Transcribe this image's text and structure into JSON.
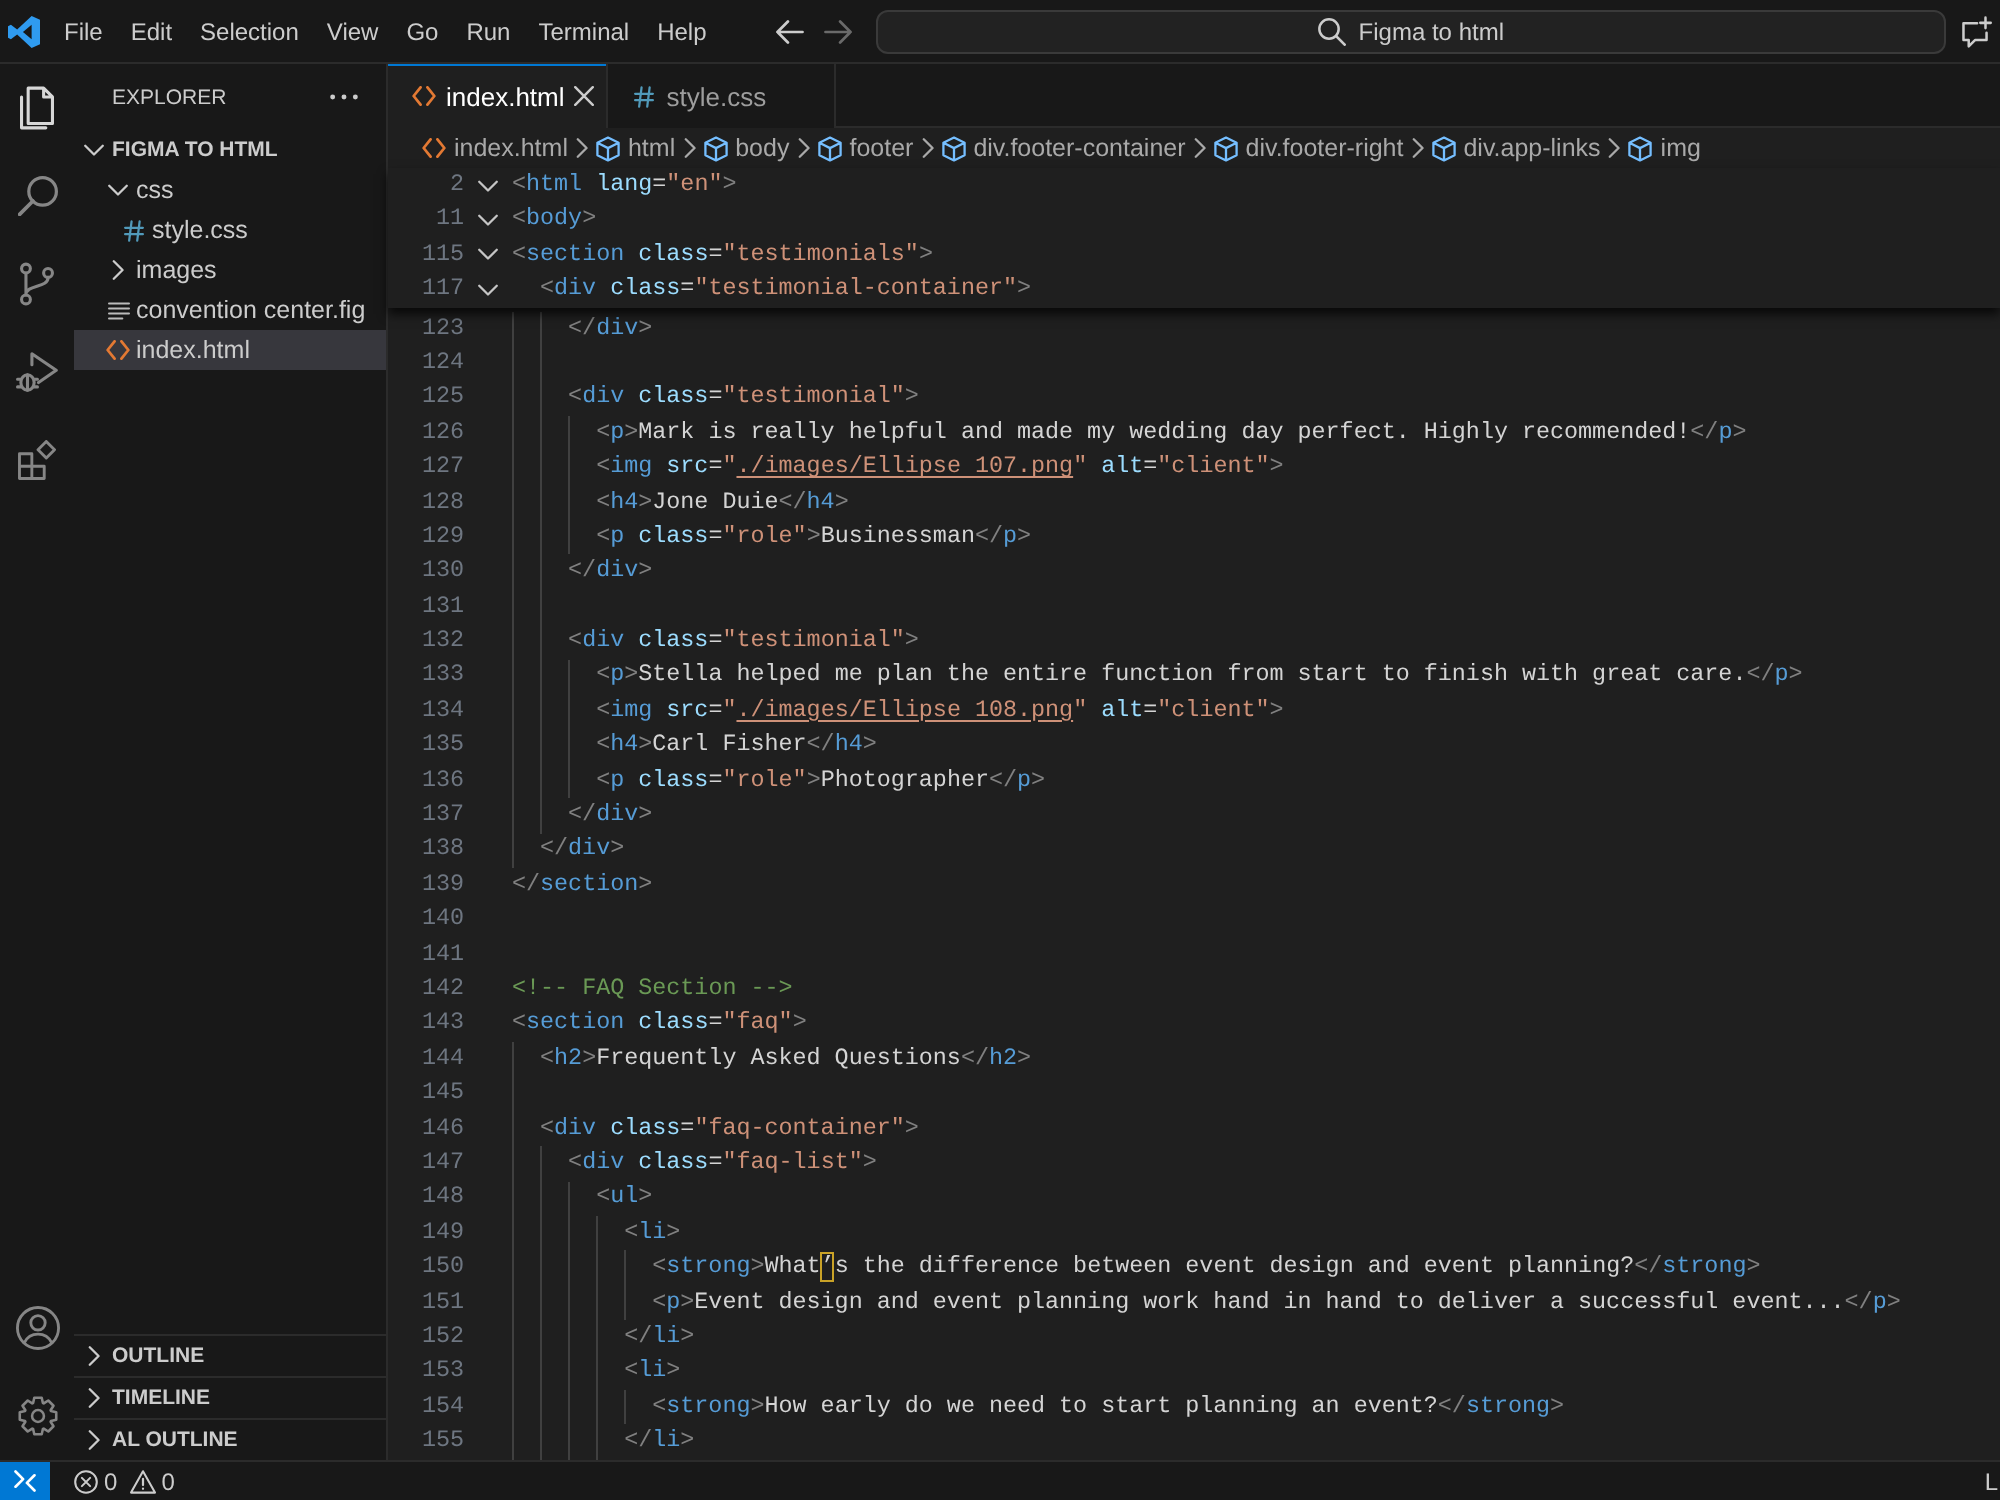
{
  "title_bar": {
    "menu": [
      "File",
      "Edit",
      "Selection",
      "View",
      "Go",
      "Run",
      "Terminal",
      "Help"
    ],
    "navigation": [
      {
        "kind": "back",
        "disabled": false
      },
      {
        "kind": "forward",
        "disabled": true
      }
    ],
    "command_center": {
      "label": "Figma to html"
    }
  },
  "activity_bar": {
    "items": [
      {
        "kind": "explorer",
        "selected": true
      },
      {
        "kind": "search",
        "selected": false
      },
      {
        "kind": "source_control",
        "selected": false
      },
      {
        "kind": "run_debug",
        "selected": false
      },
      {
        "kind": "extensions",
        "selected": false
      }
    ],
    "bottom": [
      {
        "kind": "account"
      },
      {
        "kind": "manage"
      }
    ]
  },
  "sidebar": {
    "title": "EXPLORER",
    "tree": {
      "label": "FIGMA TO HTML",
      "expanded": true,
      "children": [
        {
          "label": "css",
          "kind": "folder",
          "expanded": true,
          "selected": false,
          "children": [
            {
              "label": "style.css",
              "kind": "css",
              "selected": false
            }
          ]
        },
        {
          "label": "images",
          "kind": "folder",
          "expanded": false,
          "selected": false
        },
        {
          "label": "convention center.fig",
          "kind": "file",
          "selected": false
        },
        {
          "label": "index.html",
          "kind": "html",
          "selected": true
        }
      ]
    },
    "sections": [
      {
        "label": "OUTLINE",
        "expanded": false
      },
      {
        "label": "TIMELINE",
        "expanded": false
      },
      {
        "label": "AL OUTLINE",
        "expanded": false
      }
    ]
  },
  "editor": {
    "tabs": [
      {
        "label": "index.html",
        "kind": "html",
        "selected": true
      },
      {
        "label": "style.css",
        "kind": "css",
        "selected": false
      }
    ],
    "breadcrumbs": [
      {
        "label": "index.html",
        "kind": "html"
      },
      {
        "label": "html",
        "kind": "element"
      },
      {
        "label": "body",
        "kind": "element"
      },
      {
        "label": "footer",
        "kind": "element"
      },
      {
        "label": "div.footer-container",
        "kind": "element"
      },
      {
        "label": "div.footer-right",
        "kind": "element"
      },
      {
        "label": "div.app-links",
        "kind": "element"
      },
      {
        "label": "img",
        "kind": "element"
      }
    ],
    "sticky_scroll": [
      {
        "number": "2",
        "expanded": true,
        "tokens": [
          {
            "kind": "bracket",
            "text": "<"
          },
          {
            "kind": "tag",
            "text": "html"
          },
          {
            "kind": "attribute",
            "text": " lang"
          },
          {
            "kind": "plain",
            "text": "="
          },
          {
            "kind": "string",
            "text": "\"en\""
          },
          {
            "kind": "bracket",
            "text": ">"
          }
        ]
      },
      {
        "number": "11",
        "expanded": true,
        "tokens": [
          {
            "kind": "bracket",
            "text": "<"
          },
          {
            "kind": "tag",
            "text": "body"
          },
          {
            "kind": "bracket",
            "text": ">"
          }
        ]
      },
      {
        "number": "115",
        "expanded": true,
        "tokens": [
          {
            "kind": "bracket",
            "text": "<"
          },
          {
            "kind": "tag",
            "text": "section"
          },
          {
            "kind": "attribute",
            "text": " class"
          },
          {
            "kind": "plain",
            "text": "="
          },
          {
            "kind": "string",
            "text": "\"testimonials\""
          },
          {
            "kind": "bracket",
            "text": ">"
          }
        ]
      },
      {
        "number": "117",
        "expanded": true,
        "tokens": [
          {
            "kind": "bracket",
            "text": "  <"
          },
          {
            "kind": "tag",
            "text": "div"
          },
          {
            "kind": "attribute",
            "text": " class"
          },
          {
            "kind": "plain",
            "text": "="
          },
          {
            "kind": "string",
            "text": "\"testimonial-container\""
          },
          {
            "kind": "bracket",
            "text": ">"
          }
        ]
      }
    ],
    "lines": [
      {
        "number": "123",
        "tokens": [
          {
            "kind": "bracket",
            "text": "    </"
          },
          {
            "kind": "tag",
            "text": "div"
          },
          {
            "kind": "bracket",
            "text": ">"
          }
        ]
      },
      {
        "number": "124"
      },
      {
        "number": "125",
        "tokens": [
          {
            "kind": "bracket",
            "text": "    <"
          },
          {
            "kind": "tag",
            "text": "div"
          },
          {
            "kind": "attribute",
            "text": " class"
          },
          {
            "kind": "plain",
            "text": "="
          },
          {
            "kind": "string",
            "text": "\"testimonial\""
          },
          {
            "kind": "bracket",
            "text": ">"
          }
        ]
      },
      {
        "number": "126",
        "tokens": [
          {
            "kind": "bracket",
            "text": "      <"
          },
          {
            "kind": "tag",
            "text": "p"
          },
          {
            "kind": "bracket",
            "text": ">"
          },
          {
            "kind": "plain",
            "text": "Mark is really helpful and made my wedding day perfect. Highly recommended!"
          },
          {
            "kind": "bracket",
            "text": "</"
          },
          {
            "kind": "tag",
            "text": "p"
          },
          {
            "kind": "bracket",
            "text": ">"
          }
        ]
      },
      {
        "number": "127",
        "tokens": [
          {
            "kind": "bracket",
            "text": "      <"
          },
          {
            "kind": "tag",
            "text": "img"
          },
          {
            "kind": "attribute",
            "text": " src"
          },
          {
            "kind": "plain",
            "text": "="
          },
          {
            "kind": "string",
            "text": "\""
          },
          {
            "kind": "link",
            "text": "./images/Ellipse 107.png"
          },
          {
            "kind": "string",
            "text": "\""
          },
          {
            "kind": "attribute",
            "text": " alt"
          },
          {
            "kind": "plain",
            "text": "="
          },
          {
            "kind": "string",
            "text": "\"client\""
          },
          {
            "kind": "bracket",
            "text": ">"
          }
        ]
      },
      {
        "number": "128",
        "tokens": [
          {
            "kind": "bracket",
            "text": "      <"
          },
          {
            "kind": "tag",
            "text": "h4"
          },
          {
            "kind": "bracket",
            "text": ">"
          },
          {
            "kind": "plain",
            "text": "Jone Duie"
          },
          {
            "kind": "bracket",
            "text": "</"
          },
          {
            "kind": "tag",
            "text": "h4"
          },
          {
            "kind": "bracket",
            "text": ">"
          }
        ]
      },
      {
        "number": "129",
        "tokens": [
          {
            "kind": "bracket",
            "text": "      <"
          },
          {
            "kind": "tag",
            "text": "p"
          },
          {
            "kind": "attribute",
            "text": " class"
          },
          {
            "kind": "plain",
            "text": "="
          },
          {
            "kind": "string",
            "text": "\"role\""
          },
          {
            "kind": "bracket",
            "text": ">"
          },
          {
            "kind": "plain",
            "text": "Businessman"
          },
          {
            "kind": "bracket",
            "text": "</"
          },
          {
            "kind": "tag",
            "text": "p"
          },
          {
            "kind": "bracket",
            "text": ">"
          }
        ]
      },
      {
        "number": "130",
        "tokens": [
          {
            "kind": "bracket",
            "text": "    </"
          },
          {
            "kind": "tag",
            "text": "div"
          },
          {
            "kind": "bracket",
            "text": ">"
          }
        ]
      },
      {
        "number": "131"
      },
      {
        "number": "132",
        "tokens": [
          {
            "kind": "bracket",
            "text": "    <"
          },
          {
            "kind": "tag",
            "text": "div"
          },
          {
            "kind": "attribute",
            "text": " class"
          },
          {
            "kind": "plain",
            "text": "="
          },
          {
            "kind": "string",
            "text": "\"testimonial\""
          },
          {
            "kind": "bracket",
            "text": ">"
          }
        ]
      },
      {
        "number": "133",
        "tokens": [
          {
            "kind": "bracket",
            "text": "      <"
          },
          {
            "kind": "tag",
            "text": "p"
          },
          {
            "kind": "bracket",
            "text": ">"
          },
          {
            "kind": "plain",
            "text": "Stella helped me plan the entire function from start to finish with great care."
          },
          {
            "kind": "bracket",
            "text": "</"
          },
          {
            "kind": "tag",
            "text": "p"
          },
          {
            "kind": "bracket",
            "text": ">"
          }
        ]
      },
      {
        "number": "134",
        "tokens": [
          {
            "kind": "bracket",
            "text": "      <"
          },
          {
            "kind": "tag",
            "text": "img"
          },
          {
            "kind": "attribute",
            "text": " src"
          },
          {
            "kind": "plain",
            "text": "="
          },
          {
            "kind": "string",
            "text": "\""
          },
          {
            "kind": "link",
            "text": "./images/Ellipse 108.png"
          },
          {
            "kind": "string",
            "text": "\""
          },
          {
            "kind": "attribute",
            "text": " alt"
          },
          {
            "kind": "plain",
            "text": "="
          },
          {
            "kind": "string",
            "text": "\"client\""
          },
          {
            "kind": "bracket",
            "text": ">"
          }
        ]
      },
      {
        "number": "135",
        "tokens": [
          {
            "kind": "bracket",
            "text": "      <"
          },
          {
            "kind": "tag",
            "text": "h4"
          },
          {
            "kind": "bracket",
            "text": ">"
          },
          {
            "kind": "plain",
            "text": "Carl Fisher"
          },
          {
            "kind": "bracket",
            "text": "</"
          },
          {
            "kind": "tag",
            "text": "h4"
          },
          {
            "kind": "bracket",
            "text": ">"
          }
        ]
      },
      {
        "number": "136",
        "tokens": [
          {
            "kind": "bracket",
            "text": "      <"
          },
          {
            "kind": "tag",
            "text": "p"
          },
          {
            "kind": "attribute",
            "text": " class"
          },
          {
            "kind": "plain",
            "text": "="
          },
          {
            "kind": "string",
            "text": "\"role\""
          },
          {
            "kind": "bracket",
            "text": ">"
          },
          {
            "kind": "plain",
            "text": "Photographer"
          },
          {
            "kind": "bracket",
            "text": "</"
          },
          {
            "kind": "tag",
            "text": "p"
          },
          {
            "kind": "bracket",
            "text": ">"
          }
        ]
      },
      {
        "number": "137",
        "tokens": [
          {
            "kind": "bracket",
            "text": "    </"
          },
          {
            "kind": "tag",
            "text": "div"
          },
          {
            "kind": "bracket",
            "text": ">"
          }
        ]
      },
      {
        "number": "138",
        "tokens": [
          {
            "kind": "bracket",
            "text": "  </"
          },
          {
            "kind": "tag",
            "text": "div"
          },
          {
            "kind": "bracket",
            "text": ">"
          }
        ]
      },
      {
        "number": "139",
        "tokens": [
          {
            "kind": "bracket",
            "text": "</"
          },
          {
            "kind": "tag",
            "text": "section"
          },
          {
            "kind": "bracket",
            "text": ">"
          }
        ]
      },
      {
        "number": "140"
      },
      {
        "number": "141"
      },
      {
        "number": "142",
        "tokens": [
          {
            "kind": "comment",
            "text": "<!-- FAQ Section -->"
          }
        ]
      },
      {
        "number": "143",
        "tokens": [
          {
            "kind": "bracket",
            "text": "<"
          },
          {
            "kind": "tag",
            "text": "section"
          },
          {
            "kind": "attribute",
            "text": " class"
          },
          {
            "kind": "plain",
            "text": "="
          },
          {
            "kind": "string",
            "text": "\"faq\""
          },
          {
            "kind": "bracket",
            "text": ">"
          }
        ]
      },
      {
        "number": "144",
        "tokens": [
          {
            "kind": "bracket",
            "text": "  <"
          },
          {
            "kind": "tag",
            "text": "h2"
          },
          {
            "kind": "bracket",
            "text": ">"
          },
          {
            "kind": "plain",
            "text": "Frequently Asked Questions"
          },
          {
            "kind": "bracket",
            "text": "</"
          },
          {
            "kind": "tag",
            "text": "h2"
          },
          {
            "kind": "bracket",
            "text": ">"
          }
        ]
      },
      {
        "number": "145"
      },
      {
        "number": "146",
        "tokens": [
          {
            "kind": "bracket",
            "text": "  <"
          },
          {
            "kind": "tag",
            "text": "div"
          },
          {
            "kind": "attribute",
            "text": " class"
          },
          {
            "kind": "plain",
            "text": "="
          },
          {
            "kind": "string",
            "text": "\"faq-container\""
          },
          {
            "kind": "bracket",
            "text": ">"
          }
        ]
      },
      {
        "number": "147",
        "tokens": [
          {
            "kind": "bracket",
            "text": "    <"
          },
          {
            "kind": "tag",
            "text": "div"
          },
          {
            "kind": "attribute",
            "text": " class"
          },
          {
            "kind": "plain",
            "text": "="
          },
          {
            "kind": "string",
            "text": "\"faq-list\""
          },
          {
            "kind": "bracket",
            "text": ">"
          }
        ]
      },
      {
        "number": "148",
        "tokens": [
          {
            "kind": "bracket",
            "text": "      <"
          },
          {
            "kind": "tag",
            "text": "ul"
          },
          {
            "kind": "bracket",
            "text": ">"
          }
        ]
      },
      {
        "number": "149",
        "tokens": [
          {
            "kind": "bracket",
            "text": "        <"
          },
          {
            "kind": "tag",
            "text": "li"
          },
          {
            "kind": "bracket",
            "text": ">"
          }
        ]
      },
      {
        "number": "150",
        "tokens": [
          {
            "kind": "bracket",
            "text": "          <"
          },
          {
            "kind": "tag",
            "text": "strong"
          },
          {
            "kind": "bracket",
            "text": ">"
          },
          {
            "kind": "plain",
            "text": "What"
          },
          {
            "kind": "ambiguous",
            "text": "’"
          },
          {
            "kind": "plain",
            "text": "s the difference between event design and event planning?"
          },
          {
            "kind": "bracket",
            "text": "</"
          },
          {
            "kind": "tag",
            "text": "strong"
          },
          {
            "kind": "bracket",
            "text": ">"
          }
        ]
      },
      {
        "number": "151",
        "tokens": [
          {
            "kind": "bracket",
            "text": "          <"
          },
          {
            "kind": "tag",
            "text": "p"
          },
          {
            "kind": "bracket",
            "text": ">"
          },
          {
            "kind": "plain",
            "text": "Event design and event planning work hand in hand to deliver a successful event..."
          },
          {
            "kind": "bracket",
            "text": "</"
          },
          {
            "kind": "tag",
            "text": "p"
          },
          {
            "kind": "bracket",
            "text": ">"
          }
        ]
      },
      {
        "number": "152",
        "tokens": [
          {
            "kind": "bracket",
            "text": "        </"
          },
          {
            "kind": "tag",
            "text": "li"
          },
          {
            "kind": "bracket",
            "text": ">"
          }
        ]
      },
      {
        "number": "153",
        "tokens": [
          {
            "kind": "bracket",
            "text": "        <"
          },
          {
            "kind": "tag",
            "text": "li"
          },
          {
            "kind": "bracket",
            "text": ">"
          }
        ]
      },
      {
        "number": "154",
        "tokens": [
          {
            "kind": "bracket",
            "text": "          <"
          },
          {
            "kind": "tag",
            "text": "strong"
          },
          {
            "kind": "bracket",
            "text": ">"
          },
          {
            "kind": "plain",
            "text": "How early do we need to start planning an event?"
          },
          {
            "kind": "bracket",
            "text": "</"
          },
          {
            "kind": "tag",
            "text": "strong"
          },
          {
            "kind": "bracket",
            "text": ">"
          }
        ]
      },
      {
        "number": "155",
        "tokens": [
          {
            "kind": "bracket",
            "text": "        </"
          },
          {
            "kind": "tag",
            "text": "li"
          },
          {
            "kind": "bracket",
            "text": ">"
          }
        ]
      }
    ]
  },
  "status_bar": {
    "problems": [
      {
        "kind": "error",
        "count": "0"
      },
      {
        "kind": "warning",
        "count": "0"
      }
    ],
    "right_item": "L"
  }
}
